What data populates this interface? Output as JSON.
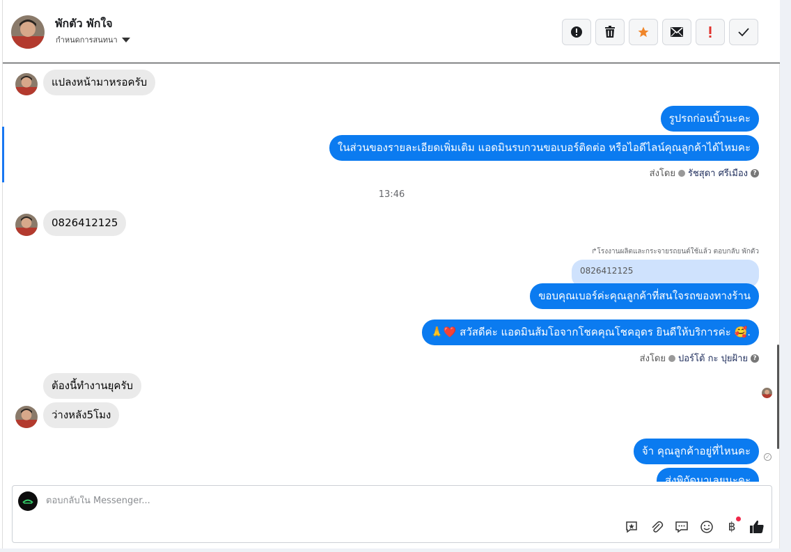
{
  "header": {
    "contact_name": "พักตัว พักใจ",
    "convo_label": "กำหนดการสนทนา"
  },
  "toolbar": {
    "buttons": [
      {
        "name": "spam-button",
        "icon": "alert-circle-icon"
      },
      {
        "name": "delete-button",
        "icon": "trash-icon"
      },
      {
        "name": "star-button",
        "icon": "star-icon"
      },
      {
        "name": "mark-unread-button",
        "icon": "envelope-icon"
      },
      {
        "name": "important-button",
        "icon": "exclamation-icon"
      },
      {
        "name": "done-button",
        "icon": "check-icon"
      }
    ]
  },
  "messages": {
    "m1": "แปลงหน้ามาหรอครับ",
    "m2": "รูปรถก่อนบิ้วนะคะ",
    "m3": "ในส่วนของรายละเอียดเพิ่มเติม แอดมินรบกวนขอเบอร์ติดต่อ หรือไอดีไลน์คุณลูกค้าได้ไหมคะ",
    "sent_by_1": {
      "prefix": "ส่งโดย",
      "agent": "รัชสุดา ศรีเมือง"
    },
    "time": "13:46",
    "m4": "0826412125",
    "reply_note": "โรงงานผลิตและกระจายรถยนต์ใช้แล้ว ตอบกลับ พักตัว",
    "quote": "0826412125",
    "m5": "ขอบคุณเบอร์ค่ะคุณลูกค้าที่สนใจรถของทางร้าน",
    "m6": "🙏❤️ สวัสดีค่ะ แอดมินส้มโอจากโชคคุณโชคอุดร ยินดีให้บริการค่ะ 🥰.",
    "sent_by_2": {
      "prefix": "ส่งโดย",
      "agent": "ปอร์โต้ กะ ปุยฝ้าย"
    },
    "m7": "ต้องนี้ทำงานยุครับ",
    "m8": "ว่างหลัง5โมง",
    "m9": "จ้า คุณลูกค้าอยู่ที่ไหนคะ",
    "m10": "ส่งพิกัดมาเลยนะคะ"
  },
  "composer": {
    "placeholder": "ตอบกลับใน Messenger...",
    "tools": [
      "quick-reply-icon",
      "paperclip-icon",
      "saved-reply-icon",
      "emoji-icon",
      "baht-icon",
      "thumbs-up-icon"
    ]
  },
  "colors": {
    "outgoing": "#0b7bf0",
    "incoming": "#eaeaea",
    "quote": "#cfe2fd"
  }
}
